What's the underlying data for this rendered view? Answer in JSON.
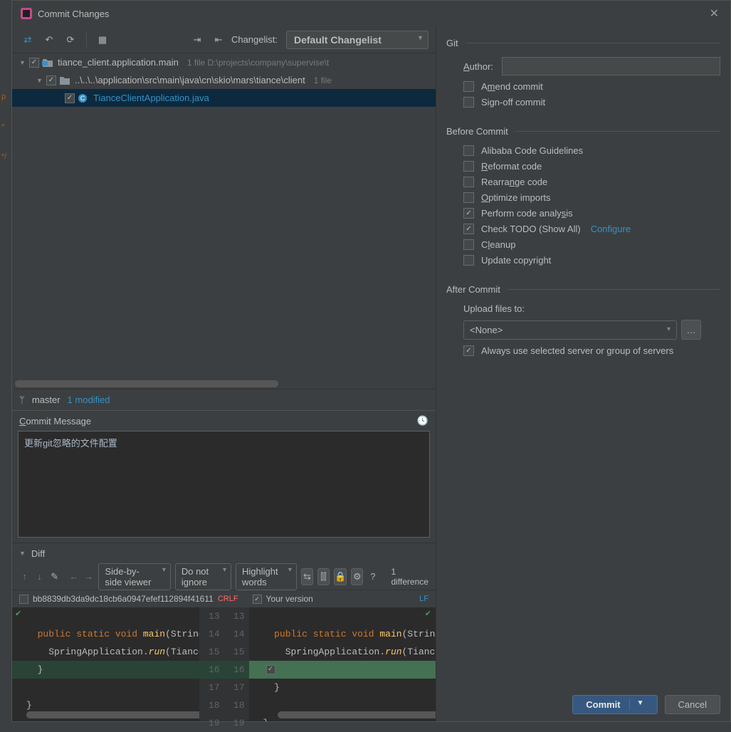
{
  "dialog": {
    "title": "Commit Changes"
  },
  "toolbar": {
    "changelist_label": "Changelist:",
    "changelist_value": "Default Changelist"
  },
  "tree": {
    "root_name": "tiance_client.application.main",
    "root_meta": "1 file  D:\\projects\\company\\supervise\\t",
    "pkg_name": "..\\..\\..\\application\\src\\main\\java\\cn\\skio\\mars\\tiance\\client",
    "pkg_meta": "1 file",
    "file_name": "TianceClientApplication.java"
  },
  "branch": {
    "name": "master",
    "modified": "1 modified"
  },
  "commit_message": {
    "label": "Commit Message",
    "value": "更新git忽略的文件配置"
  },
  "diff": {
    "label": "Diff",
    "viewer": "Side-by-side viewer",
    "ignore": "Do not ignore",
    "highlight": "Highlight words",
    "count": "1 difference",
    "hash": "bb8839db3da9dc18cb6a0947efef112894f41611",
    "left_enc": "CRLF",
    "right_label": "Your version",
    "right_enc": "LF",
    "line_nums": [
      "13",
      "14",
      "15",
      "16",
      "17",
      "18",
      "19"
    ]
  },
  "git": {
    "section": "Git",
    "author_label": "Author:",
    "amend": "Amend commit",
    "signoff": "Sign-off commit"
  },
  "before": {
    "section": "Before Commit",
    "alibaba": "Alibaba Code Guidelines",
    "reformat": "Reformat code",
    "rearrange": "Rearrange code",
    "optimize": "Optimize imports",
    "analysis": "Perform code analysis",
    "todo": "Check TODO (Show All)",
    "configure": "Configure",
    "cleanup": "Cleanup",
    "copyright": "Update copyright"
  },
  "after": {
    "section": "After Commit",
    "upload_label": "Upload files to:",
    "upload_value": "<None>",
    "always": "Always use selected server or group of servers"
  },
  "buttons": {
    "commit": "Commit",
    "cancel": "Cancel"
  }
}
